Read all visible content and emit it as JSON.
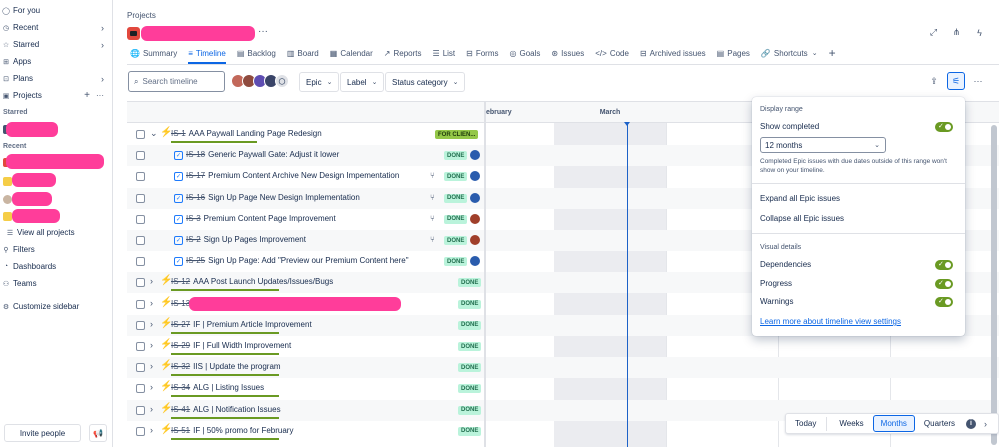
{
  "sidebar": {
    "items": [
      {
        "label": "For you",
        "icon": "person-icon"
      },
      {
        "label": "Recent",
        "icon": "clock-icon",
        "chevron": true
      },
      {
        "label": "Starred",
        "icon": "star-icon",
        "chevron": true
      },
      {
        "label": "Apps",
        "icon": "apps-icon"
      },
      {
        "label": "Plans",
        "icon": "plans-icon",
        "chevron": true
      },
      {
        "label": "Projects",
        "icon": "projects-icon"
      }
    ],
    "starred_label": "Starred",
    "recent_label": "Recent",
    "view_all_projects": "View all projects",
    "bottom_items": [
      {
        "label": "Filters",
        "icon": "filter-icon"
      },
      {
        "label": "Dashboards",
        "icon": "dashboard-icon"
      },
      {
        "label": "Teams",
        "icon": "teams-icon"
      }
    ],
    "customize": "Customize sidebar",
    "invite": "Invite people"
  },
  "header": {
    "breadcrumb": "Projects",
    "more": "···"
  },
  "tabs": [
    {
      "label": "Summary",
      "icon": "🌐",
      "active": false
    },
    {
      "label": "Timeline",
      "icon": "≡",
      "active": true
    },
    {
      "label": "Backlog",
      "icon": "▤",
      "active": false
    },
    {
      "label": "Board",
      "icon": "▥",
      "active": false
    },
    {
      "label": "Calendar",
      "icon": "▦",
      "active": false
    },
    {
      "label": "Reports",
      "icon": "↗",
      "active": false
    },
    {
      "label": "List",
      "icon": "☰",
      "active": false
    },
    {
      "label": "Forms",
      "icon": "⊟",
      "active": false
    },
    {
      "label": "Goals",
      "icon": "◎",
      "active": false
    },
    {
      "label": "Issues",
      "icon": "⊛",
      "active": false
    },
    {
      "label": "Code",
      "icon": "</>",
      "active": false
    },
    {
      "label": "Archived issues",
      "icon": "⊟",
      "active": false
    },
    {
      "label": "Pages",
      "icon": "▤",
      "active": false
    },
    {
      "label": "Shortcuts",
      "icon": "🔗",
      "active": false
    }
  ],
  "toolbar": {
    "search_placeholder": "Search timeline",
    "epic": "Epic",
    "label": "Label",
    "status_category": "Status category"
  },
  "timeline": {
    "months": [
      "ebruary",
      "March"
    ],
    "rows": [
      {
        "key": "IS-1",
        "title": "AAA Paywall Landing Page Redesign",
        "type": "epic",
        "expanded": true,
        "status": "FOR CLIEN...",
        "status_type": "forcli",
        "progress": 0.48
      },
      {
        "key": "IS-18",
        "title": "Generic Paywall Gate: Adjust it lower",
        "type": "story",
        "status": "DONE",
        "assignee": "blue"
      },
      {
        "key": "IS-17",
        "title": "Premium Content Archive New Design Impementation",
        "type": "story",
        "status": "DONE",
        "assignee": "blue",
        "child": true
      },
      {
        "key": "IS-16",
        "title": "Sign Up Page New Design Implementation",
        "type": "story",
        "status": "DONE",
        "assignee": "blue",
        "child": true
      },
      {
        "key": "IS-3",
        "title": "Premium Content Page Improvement",
        "type": "story",
        "status": "DONE",
        "assignee": "red",
        "child": true
      },
      {
        "key": "IS-2",
        "title": "Sign Up Pages Improvement",
        "type": "story",
        "status": "DONE",
        "assignee": "red",
        "child": true
      },
      {
        "key": "IS-25",
        "title": "Sign Up Page: Add \"Preview our Premium Content here\"",
        "type": "story",
        "status": "DONE",
        "assignee": "blue"
      },
      {
        "key": "IS-12",
        "title": "AAA Post Launch Updates/Issues/Bugs",
        "type": "epic",
        "status": "DONE",
        "progress": 0.6
      },
      {
        "key": "IS-13",
        "title": "",
        "type": "epic",
        "status": "DONE",
        "redacted": true
      },
      {
        "key": "IS-27",
        "title": "IF | Premium Article Improvement",
        "type": "epic",
        "status": "DONE",
        "progress": 0.6
      },
      {
        "key": "IS-29",
        "title": "IF | Full Width Improvement",
        "type": "epic",
        "status": "DONE",
        "progress": 0.6
      },
      {
        "key": "IS-32",
        "title": "IIS | Update the program",
        "type": "epic",
        "status": "DONE",
        "progress": 0.6
      },
      {
        "key": "IS-34",
        "title": "ALG | Listing Issues",
        "type": "epic",
        "status": "DONE",
        "progress": 0.6
      },
      {
        "key": "IS-41",
        "title": "ALG | Notification Issues",
        "type": "epic",
        "status": "DONE",
        "progress": 0.6
      },
      {
        "key": "IS-51",
        "title": "IF | 50% promo for February",
        "type": "epic",
        "status": "DONE",
        "progress": 0.6
      }
    ]
  },
  "settings_panel": {
    "display_range": "Display range",
    "show_completed": "Show completed",
    "range_value": "12 months",
    "range_note": "Completed Epic issues with due dates outside of this range won't show on your timeline.",
    "expand_all": "Expand all Epic issues",
    "collapse_all": "Collapse all Epic issues",
    "visual_details": "Visual details",
    "dependencies": "Dependencies",
    "progress": "Progress",
    "warnings": "Warnings",
    "learn_more": "Learn more about timeline view settings"
  },
  "zoom": {
    "today": "Today",
    "weeks": "Weeks",
    "months": "Months",
    "quarters": "Quarters",
    "active": "Months"
  }
}
